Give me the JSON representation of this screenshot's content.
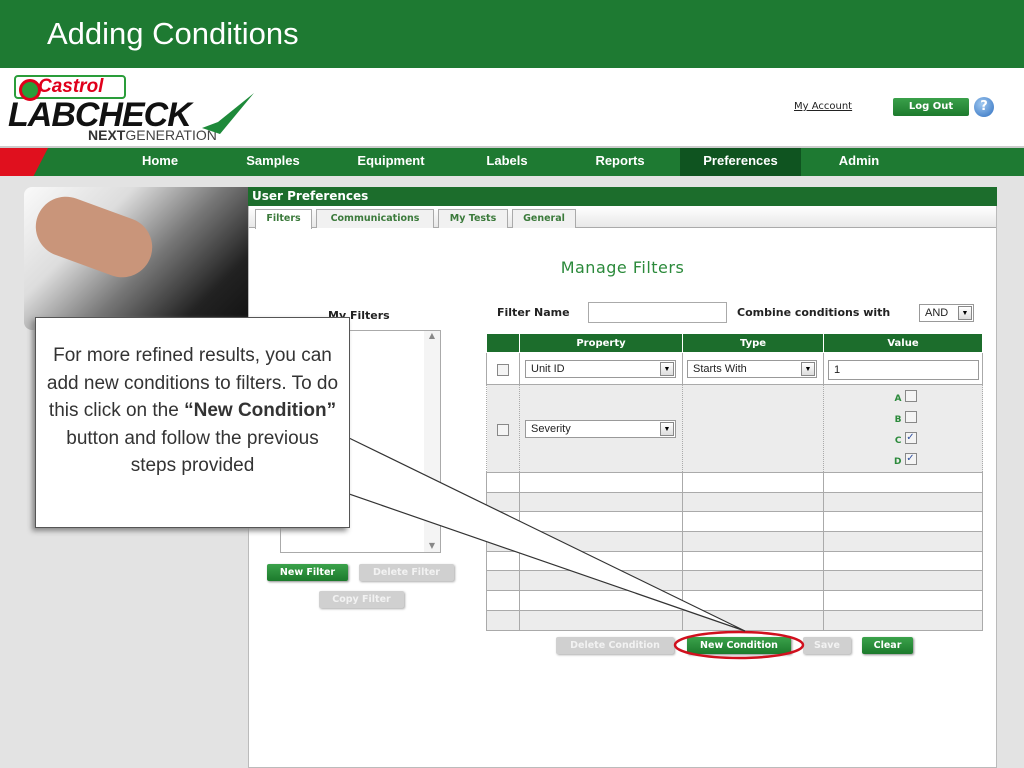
{
  "slide_title": "Adding Conditions",
  "logo": {
    "brand": "Castrol",
    "product": "LABCHECK",
    "next": "NEXT",
    "generation": "GENERATION"
  },
  "header": {
    "my_account": "My Account",
    "log_out": "Log Out",
    "help": "?"
  },
  "nav": [
    "Home",
    "Samples",
    "Equipment",
    "Labels",
    "Reports",
    "Preferences",
    "Admin"
  ],
  "nav_active": "Preferences",
  "panel": {
    "title": "User Preferences",
    "tabs": [
      "Filters",
      "Communications",
      "My Tests",
      "General"
    ],
    "active_tab": "Filters"
  },
  "manage": {
    "title": "Manage Filters",
    "my_filters": "My Filters",
    "filter_name_label": "Filter Name",
    "filter_name_value": "",
    "combine_label": "Combine conditions with",
    "combine_value": "AND"
  },
  "filter_buttons": {
    "new": "New Filter",
    "delete": "Delete Filter",
    "copy": "Copy Filter"
  },
  "table": {
    "headers": [
      "",
      "Property",
      "Type",
      "Value"
    ],
    "rows": [
      {
        "property": "Unit ID",
        "type": "Starts With",
        "value": "1"
      },
      {
        "property": "Severity",
        "levels": [
          {
            "label": "A",
            "checked": false
          },
          {
            "label": "B",
            "checked": false
          },
          {
            "label": "C",
            "checked": true
          },
          {
            "label": "D",
            "checked": true
          }
        ]
      }
    ]
  },
  "condition_buttons": {
    "delete": "Delete Condition",
    "new": "New Condition",
    "save": "Save",
    "clear": "Clear"
  },
  "callout": {
    "line1": "For more refined results, you can add new conditions to filters. To do this click on the ",
    "bold": "“New Condition”",
    "line2": " button and follow the previous steps provided"
  },
  "colors": {
    "brand_green": "#1e7a32",
    "highlight": "#d0101e"
  }
}
